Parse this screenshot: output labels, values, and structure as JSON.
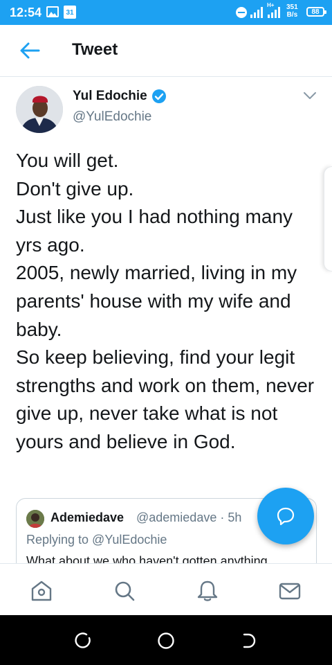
{
  "status_bar": {
    "time": "12:54",
    "calendar_day": "31",
    "network_type": "H+",
    "speed_value": "351",
    "speed_unit": "B/s",
    "battery": "88",
    "accent_color": "#1da1f2"
  },
  "header": {
    "back_icon": "arrow-left-icon",
    "title": "Tweet"
  },
  "tweet": {
    "author_name": "Yul Edochie",
    "author_handle": "@YulEdochie",
    "verified": true,
    "text": "You will get.\nDon't give up.\nJust like you I had nothing many yrs ago.\n2005, newly married, living in my parents' house with my wife and baby.\nSo keep believing, find your legit strengths and work on them, never give up, never take what is not yours and believe in God."
  },
  "quoted_tweet": {
    "author_name": "Ademiedave",
    "author_handle": "@ademiedave · 5h",
    "replying_to": "Replying to @YulEdochie",
    "text_preview": "What about we who haven't gotten anything"
  },
  "fab": {
    "icon": "reply-bubble-icon"
  },
  "bottom_nav": {
    "items": [
      {
        "icon": "home-icon"
      },
      {
        "icon": "search-icon"
      },
      {
        "icon": "bell-icon"
      },
      {
        "icon": "mail-icon"
      }
    ]
  },
  "system_nav": {
    "items": [
      {
        "icon": "recents-icon"
      },
      {
        "icon": "home-circle-icon"
      },
      {
        "icon": "back-icon"
      }
    ]
  }
}
